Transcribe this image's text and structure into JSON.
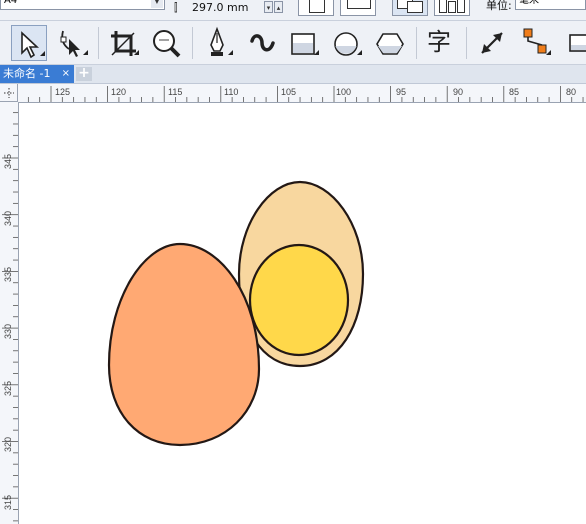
{
  "property_bar": {
    "paper_size": "A4",
    "page_height": "297.0 mm",
    "spin_down": "▾",
    "spin_up": "▴",
    "units_label": "单位:",
    "units_value": "毫米"
  },
  "toolbox": {
    "tools": [
      {
        "name": "pick-tool",
        "icon": "arrow-cursor-icon"
      },
      {
        "name": "shape-tool",
        "icon": "node-edit-icon"
      },
      {
        "name": "crop-tool",
        "icon": "crop-icon"
      },
      {
        "name": "zoom-tool",
        "icon": "magnifier-icon"
      },
      {
        "name": "pen-tool",
        "icon": "pen-nib-icon"
      },
      {
        "name": "artistic-media-tool",
        "icon": "brush-stroke-icon"
      },
      {
        "name": "rectangle-tool",
        "icon": "rectangle-icon"
      },
      {
        "name": "ellipse-tool",
        "icon": "ellipse-icon"
      },
      {
        "name": "polygon-tool",
        "icon": "hexagon-icon"
      },
      {
        "name": "text-tool",
        "icon": "text-icon",
        "label": "字"
      },
      {
        "name": "dimension-tool",
        "icon": "diagonal-arrow-icon"
      },
      {
        "name": "connector-tool",
        "icon": "connector-icon"
      },
      {
        "name": "interactive-tool",
        "icon": "drop-shadow-icon"
      }
    ]
  },
  "document_tabs": [
    {
      "label": "未命名 -1",
      "close": "×",
      "active": true
    }
  ],
  "add_tab": "+",
  "horizontal_ruler": {
    "ticks": [
      "125",
      "120",
      "115",
      "110",
      "105",
      "100",
      "95",
      "90",
      "85",
      "80"
    ]
  },
  "vertical_ruler": {
    "ticks": [
      "345",
      "340",
      "335",
      "330",
      "325",
      "320",
      "315"
    ]
  },
  "shapes": {
    "left_egg_fill": "#ffa973",
    "back_egg_fill": "#f8d79f",
    "inner_circle_fill": "#ffd84a",
    "outline": "#231815"
  }
}
